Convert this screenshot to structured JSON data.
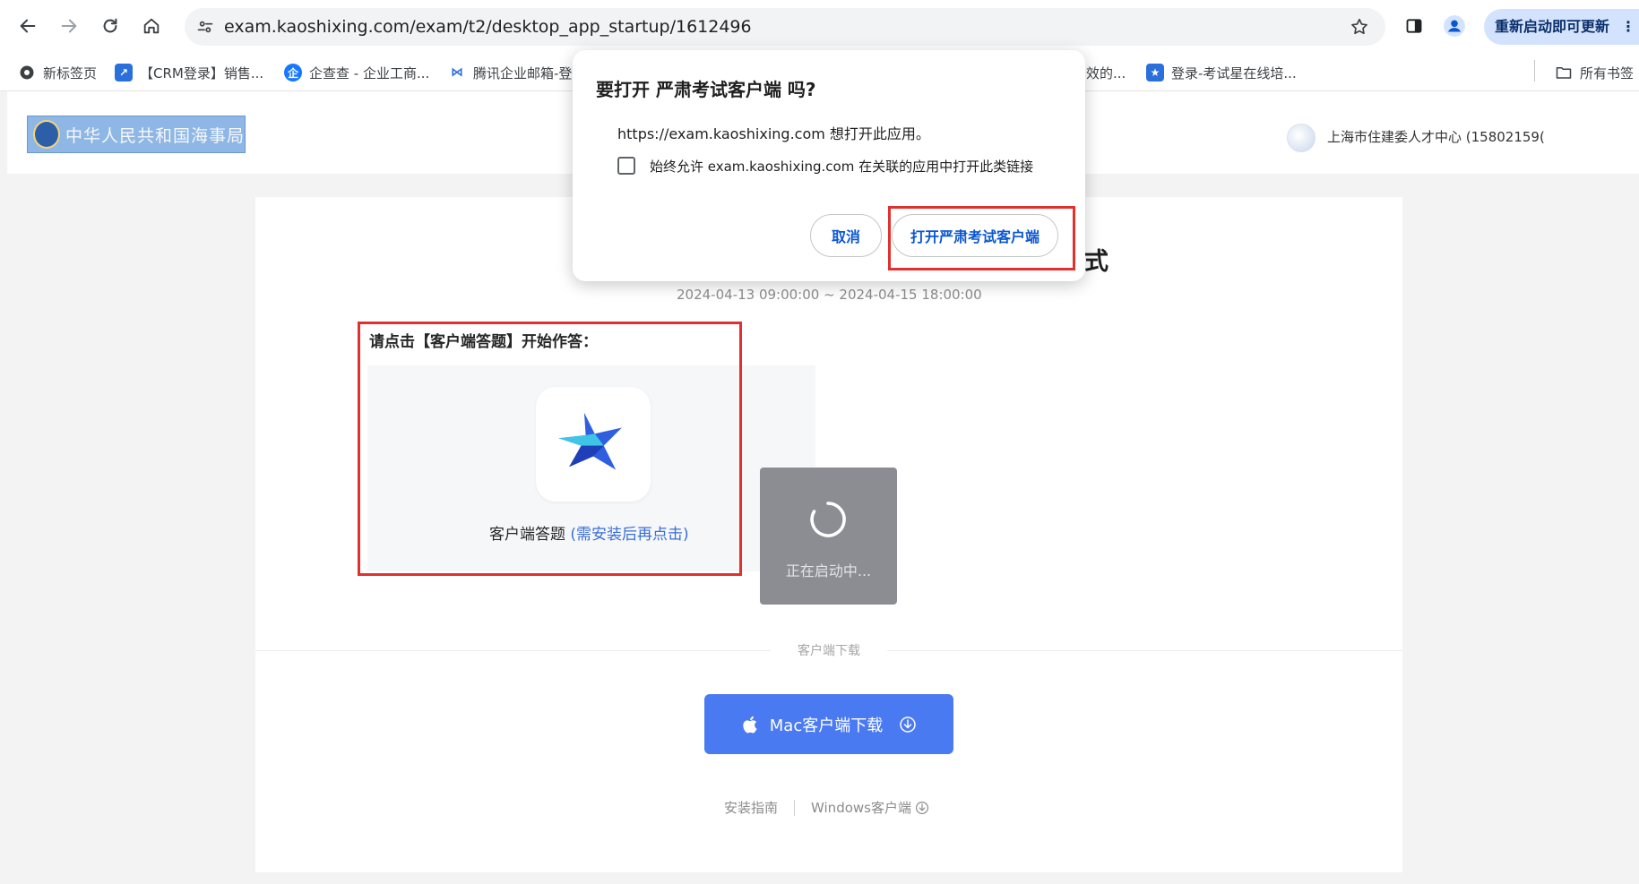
{
  "browser": {
    "url": "exam.kaoshixing.com/exam/t2/desktop_app_startup/1612496",
    "update_button": "重新启动即可更新",
    "update_menu": "⋮"
  },
  "bookmarks": {
    "items": [
      {
        "label": "新标签页"
      },
      {
        "label": "【CRM登录】销售..."
      },
      {
        "label": "企查查 - 企业工商..."
      },
      {
        "label": "腾讯企业邮箱-登"
      },
      {
        "label": "效的..."
      },
      {
        "label": "登录-考试星在线培..."
      }
    ],
    "all_bookmarks": "所有书签"
  },
  "header": {
    "logo_text": "中华人民共和国海事局",
    "user_name": "上海市住建委人才中心 (15802159("
  },
  "exam": {
    "title_tail": "式",
    "time_range": "2024-04-13 09:00:00 ~ 2024-04-15 18:00:00"
  },
  "client": {
    "prompt": "请点击【客户端答题】开始作答：",
    "label": "客户端答题 ",
    "hint": "(需安装后再点击)",
    "starting": "正在启动中..."
  },
  "download": {
    "divider": "客户端下载",
    "mac_button": "Mac客户端下载",
    "install_guide": "安装指南",
    "windows_client": "Windows客户端"
  },
  "dialog": {
    "title": "要打开 严肃考试客户端 吗?",
    "message": "https://exam.kaoshixing.com 想打开此应用。",
    "checkbox_label": "始终允许 exam.kaoshixing.com 在关联的应用中打开此类链接",
    "cancel": "取消",
    "open": "打开严肃考试客户端"
  },
  "colors": {
    "accent": "#4a7af2",
    "annotation": "#e0312f",
    "chrome_blue": "#0b57d0"
  }
}
